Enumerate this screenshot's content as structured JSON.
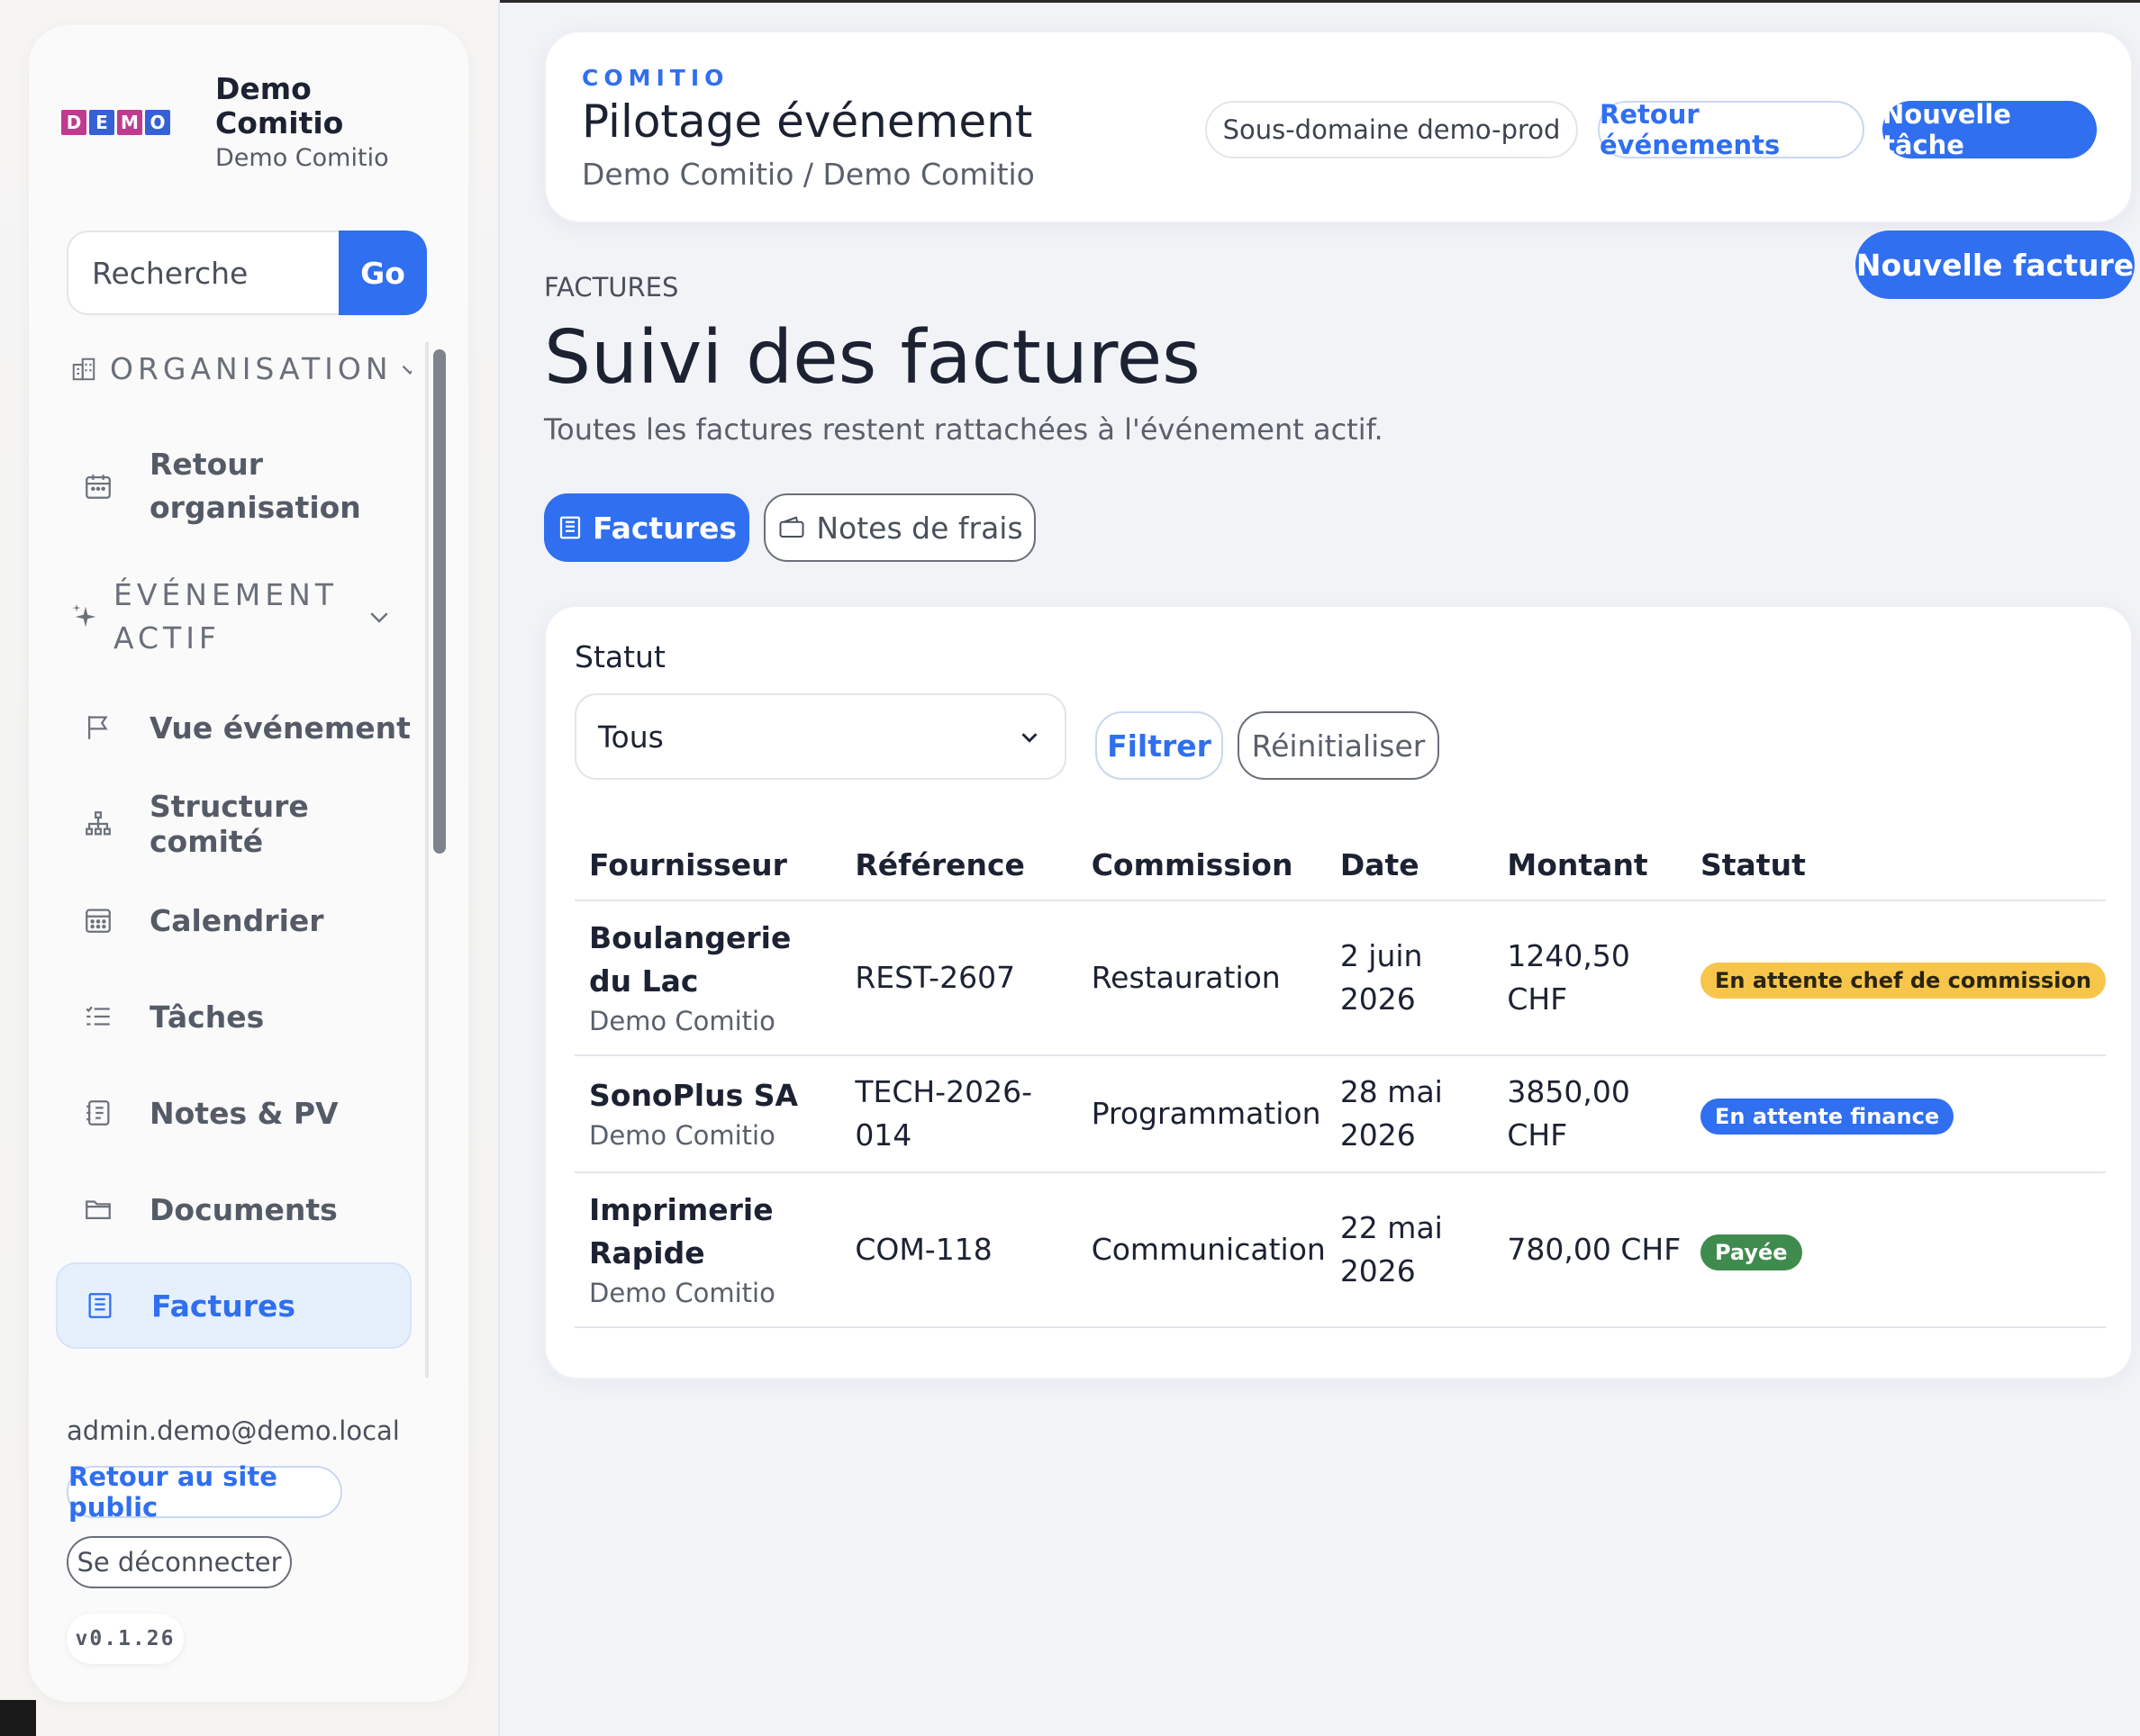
{
  "brand": {
    "logo_letters": [
      "D",
      "E",
      "M",
      "O"
    ],
    "logo_colors": [
      "#c03b8f",
      "#3560d8",
      "#c03b8f",
      "#3560d8"
    ],
    "name": "Demo Comitio",
    "subtitle": "Demo Comitio"
  },
  "search": {
    "placeholder": "Recherche",
    "button": "Go"
  },
  "sidebar": {
    "organisation_label": "ORGANISATION",
    "organisation_icon": "building-icon",
    "event_label": "ÉVÉNEMENT ACTIF",
    "event_icon": "sparkle-icon",
    "items": [
      {
        "label": "Retour organisation",
        "icon": "calendar-back-icon"
      },
      {
        "label": "Vue événement",
        "icon": "flag-icon"
      },
      {
        "label": "Structure comité",
        "icon": "org-chart-icon"
      },
      {
        "label": "Calendrier",
        "icon": "calendar-icon"
      },
      {
        "label": "Tâches",
        "icon": "list-icon"
      },
      {
        "label": "Notes & PV",
        "icon": "notes-icon"
      },
      {
        "label": "Documents",
        "icon": "folder-icon"
      },
      {
        "label": "Factures",
        "icon": "invoice-icon"
      }
    ],
    "active_item": "Factures"
  },
  "footer": {
    "email": "admin.demo@demo.local",
    "public_site": "Retour au site public",
    "logout": "Se déconnecter",
    "version": "v0.1.26"
  },
  "header": {
    "eyebrow": "COMITIO",
    "title": "Pilotage événement",
    "breadcrumb": "Demo Comitio / Demo Comitio",
    "subdomain": "Sous-domaine demo-prod",
    "back_events": "Retour événements",
    "new_task": "Nouvelle tâche"
  },
  "page": {
    "kicker": "FACTURES",
    "title": "Suivi des factures",
    "description": "Toutes les factures restent rattachées à l'événement actif.",
    "new_invoice": "Nouvelle facture"
  },
  "tabs": [
    {
      "label": "Factures",
      "active": true
    },
    {
      "label": "Notes de frais",
      "active": false
    }
  ],
  "filter": {
    "label": "Statut",
    "selected": "Tous",
    "apply": "Filtrer",
    "reset": "Réinitialiser"
  },
  "table": {
    "columns": [
      "Fournisseur",
      "Référence",
      "Commission",
      "Date",
      "Montant",
      "Statut"
    ],
    "rows": [
      {
        "supplier": "Boulangerie du Lac",
        "organisation": "Demo Comitio",
        "reference": "REST-2607",
        "commission": "Restauration",
        "date": "2 juin 2026",
        "amount": "1240,50 CHF",
        "status": "En attente chef de commission",
        "status_color": "#f6c54a"
      },
      {
        "supplier": "SonoPlus SA",
        "organisation": "Demo Comitio",
        "reference": "TECH-2026-014",
        "commission": "Programmation",
        "date": "28 mai 2026",
        "amount": "3850,00 CHF",
        "status": "En attente finance",
        "status_color": "#2f6ff0"
      },
      {
        "supplier": "Imprimerie Rapide",
        "organisation": "Demo Comitio",
        "reference": "COM-118",
        "commission": "Communication",
        "date": "22 mai 2026",
        "amount": "780,00 CHF",
        "status": "Payée",
        "status_color": "#3f8b4e"
      }
    ]
  },
  "colors": {
    "accent": "#2f6ff0",
    "active_bg": "#e6effc"
  }
}
